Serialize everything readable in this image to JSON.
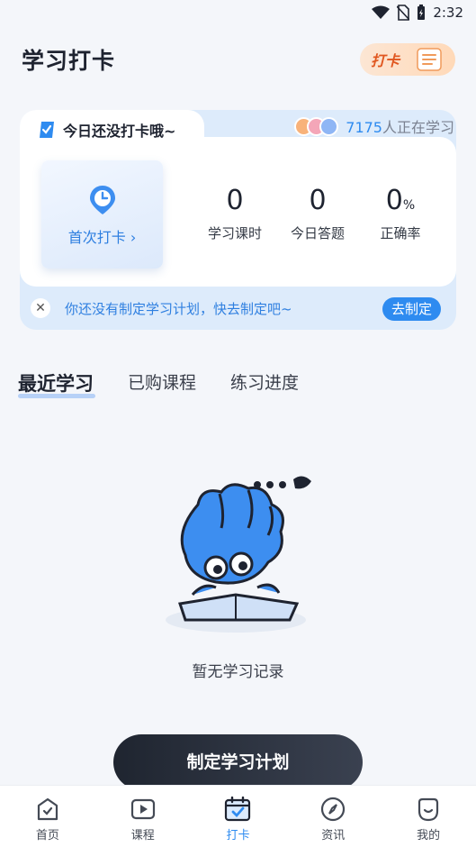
{
  "status_bar": {
    "time": "2:32"
  },
  "header": {
    "title": "学习打卡",
    "badge_label": "打卡"
  },
  "checkin_card": {
    "tab_title": "今日还没打卡哦~",
    "learner_count": "7175",
    "learner_suffix": "人正在学习",
    "first_checkin_label": "首次打卡 ›",
    "stats": [
      {
        "value": "0",
        "unit": "",
        "label": "学习课时"
      },
      {
        "value": "0",
        "unit": "",
        "label": "今日答题"
      },
      {
        "value": "0",
        "unit": "%",
        "label": "正确率"
      }
    ],
    "plan_prompt": "你还没有制定学习计划，快去制定吧~",
    "plan_button": "去制定"
  },
  "tabs": [
    {
      "label": "最近学习",
      "active": true
    },
    {
      "label": "已购课程",
      "active": false
    },
    {
      "label": "练习进度",
      "active": false
    }
  ],
  "empty_state": {
    "text": "暂无学习记录"
  },
  "cta_button": "制定学习计划",
  "bottom_nav": [
    {
      "label": "首页",
      "icon": "home-icon",
      "active": false
    },
    {
      "label": "课程",
      "icon": "play-icon",
      "active": false
    },
    {
      "label": "打卡",
      "icon": "calendar-check-icon",
      "active": true
    },
    {
      "label": "资讯",
      "icon": "compass-icon",
      "active": false
    },
    {
      "label": "我的",
      "icon": "profile-icon",
      "active": false
    }
  ],
  "colors": {
    "accent": "#2E8BF0",
    "badge": "#E0561F",
    "cta": "#1F2530"
  }
}
